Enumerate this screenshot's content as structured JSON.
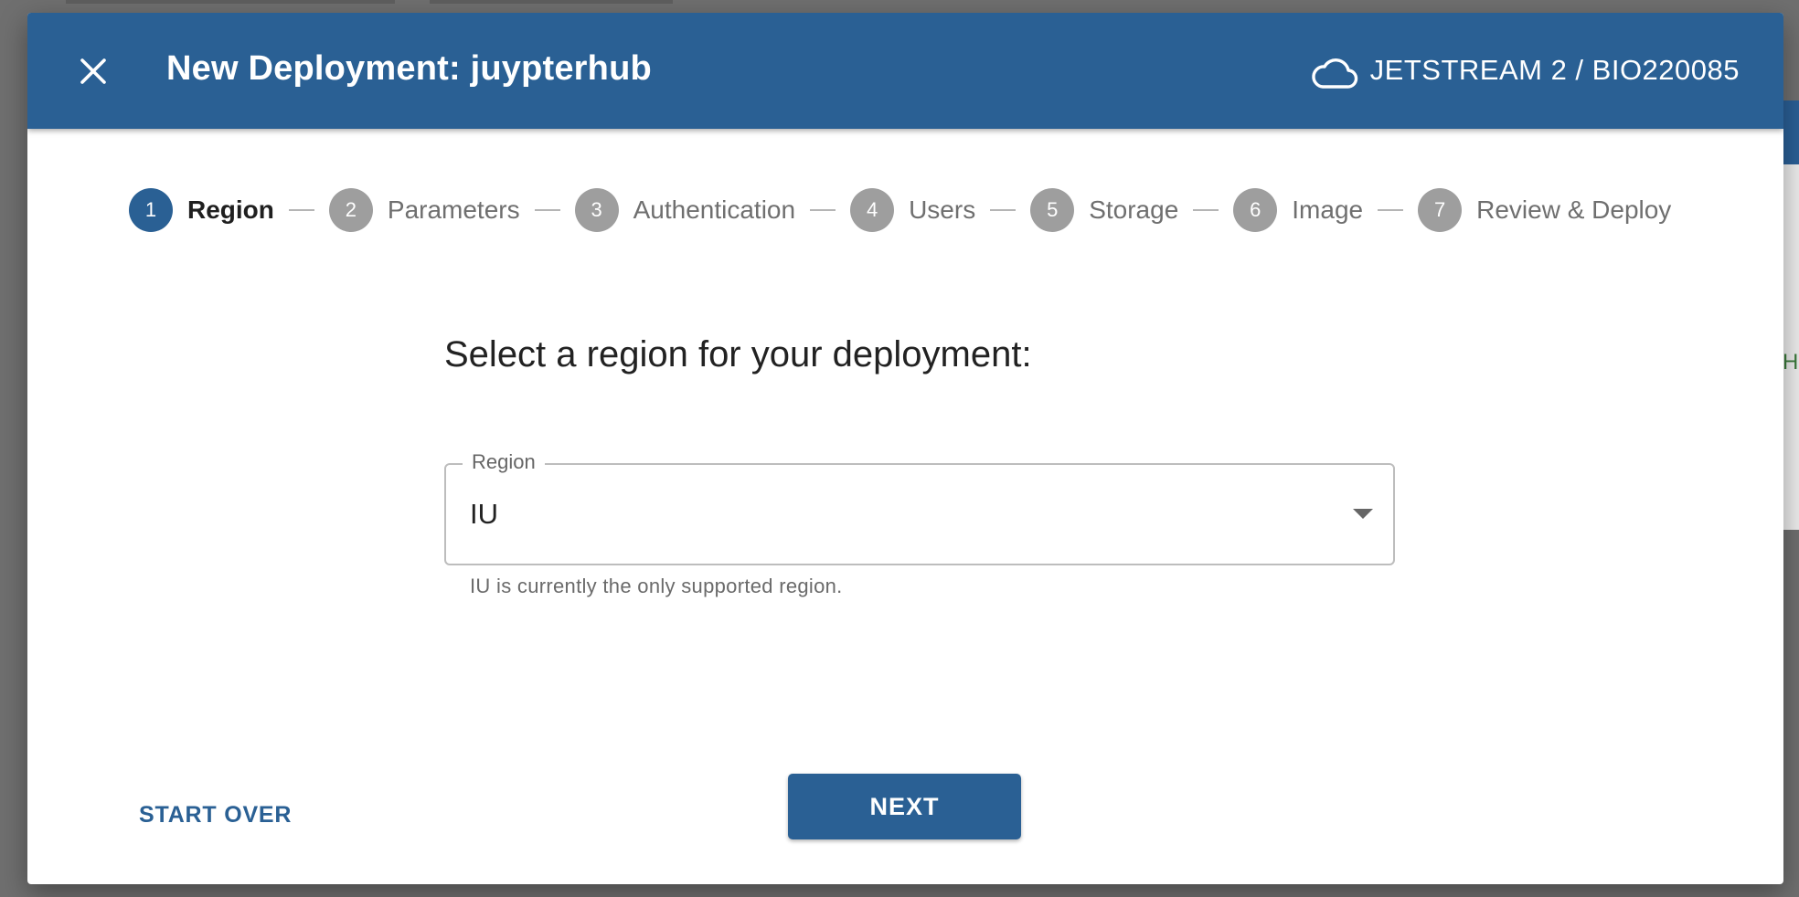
{
  "dialog": {
    "title": "New Deployment: juypterhub",
    "provider": "JETSTREAM 2 / BIO220085",
    "close_icon": "close-icon",
    "cloud_icon": "cloud-icon"
  },
  "stepper": {
    "steps": [
      {
        "number": "1",
        "label": "Region",
        "active": true
      },
      {
        "number": "2",
        "label": "Parameters",
        "active": false
      },
      {
        "number": "3",
        "label": "Authentication",
        "active": false
      },
      {
        "number": "4",
        "label": "Users",
        "active": false
      },
      {
        "number": "5",
        "label": "Storage",
        "active": false
      },
      {
        "number": "6",
        "label": "Image",
        "active": false
      },
      {
        "number": "7",
        "label": "Review & Deploy",
        "active": false
      }
    ]
  },
  "main": {
    "prompt": "Select a region for your deployment:",
    "region_label": "Region",
    "region_value": "IU",
    "region_hint": "IU is currently the only supported region."
  },
  "footer": {
    "start_over": "START OVER",
    "next": "NEXT"
  },
  "colors": {
    "primary": "#2a6094",
    "inactive_step": "#9e9e9e"
  }
}
